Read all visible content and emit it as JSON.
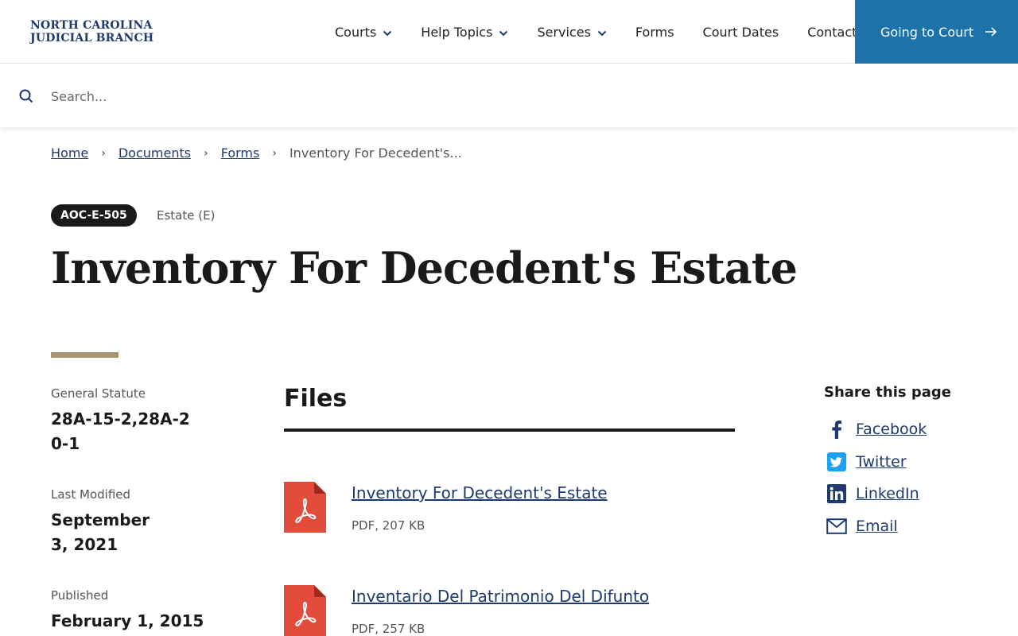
{
  "header": {
    "logo_line1": "NORTH CAROLINA",
    "logo_line2": "JUDICIAL BRANCH",
    "nav": [
      {
        "label": "Courts",
        "dropdown": true
      },
      {
        "label": "Help Topics",
        "dropdown": true
      },
      {
        "label": "Services",
        "dropdown": true
      },
      {
        "label": "Forms",
        "dropdown": false
      },
      {
        "label": "Court Dates",
        "dropdown": false
      },
      {
        "label": "Contact",
        "dropdown": false
      }
    ],
    "cta_label": "Going to Court",
    "cta_color": "#1d72aa"
  },
  "search": {
    "placeholder": "Search..."
  },
  "breadcrumb": {
    "items": [
      "Home",
      "Documents",
      "Forms"
    ],
    "current": "Inventory For Decedent's..."
  },
  "form": {
    "code": "AOC-E-505",
    "category": "Estate (E)",
    "title": "Inventory For Decedent's Estate",
    "accent_color": "#a8956d"
  },
  "meta": {
    "statute_label": "General Statute",
    "statute_value": "28A-15-2,28A-20-1",
    "modified_label": "Last Modified",
    "modified_value": "September 3, 2021",
    "published_label": "Published",
    "published_value": "February 1, 2015"
  },
  "files": {
    "heading": "Files",
    "items": [
      {
        "name": "Inventory For Decedent's Estate",
        "meta": "PDF, 207 KB",
        "icon": "pdf-icon"
      },
      {
        "name": "Inventario Del Patrimonio Del Difunto",
        "meta": "PDF, 257 KB",
        "icon": "pdf-icon"
      }
    ],
    "pdf_color": "#e34b3a"
  },
  "share": {
    "heading": "Share this page",
    "items": [
      {
        "label": "Facebook",
        "icon": "facebook-icon"
      },
      {
        "label": "Twitter",
        "icon": "twitter-icon"
      },
      {
        "label": "LinkedIn",
        "icon": "linkedin-icon"
      },
      {
        "label": "Email",
        "icon": "email-icon"
      }
    ]
  }
}
